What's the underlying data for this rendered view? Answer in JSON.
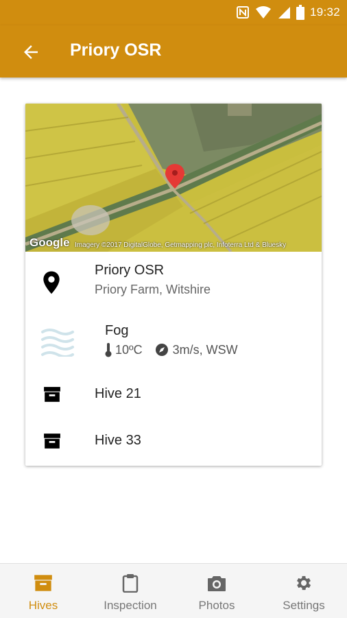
{
  "status_bar": {
    "time": "19:32"
  },
  "app_bar": {
    "title": "Priory OSR"
  },
  "map": {
    "google_label": "Google",
    "attribution": "Imagery ©2017 DigitalGlobe, Getmapping plc, Infoterra Ltd & Bluesky"
  },
  "location": {
    "name": "Priory OSR",
    "subtitle": "Priory Farm, Witshire"
  },
  "weather": {
    "condition": "Fog",
    "temperature": "10ºC",
    "wind": "3m/s, WSW"
  },
  "hives": [
    {
      "label": "Hive 21"
    },
    {
      "label": "Hive 33"
    }
  ],
  "bottom_nav": {
    "tabs": [
      {
        "label": "Hives",
        "icon": "archive-icon",
        "active": true
      },
      {
        "label": "Inspection",
        "icon": "clipboard-icon"
      },
      {
        "label": "Photos",
        "icon": "camera-icon"
      },
      {
        "label": "Settings",
        "icon": "gear-icon"
      }
    ]
  },
  "colors": {
    "accent": "#d08d0f",
    "active_tab": "#d08d0f",
    "inactive_tab": "#777777"
  }
}
